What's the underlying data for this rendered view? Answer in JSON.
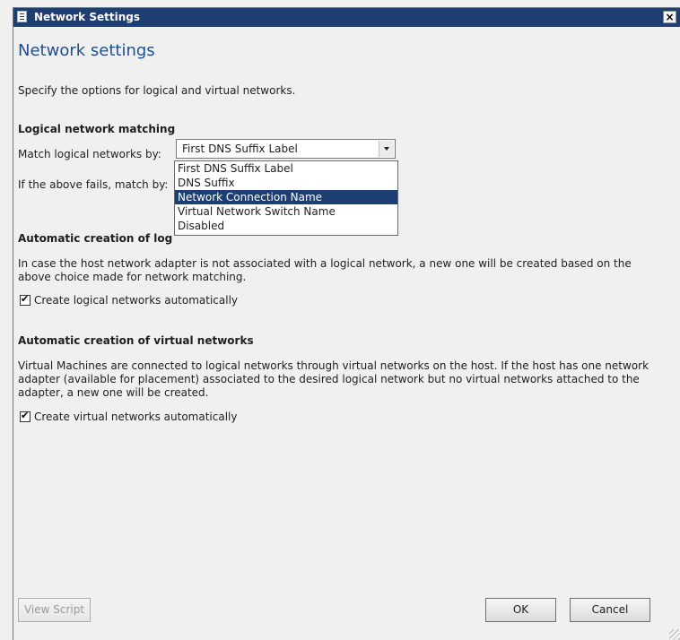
{
  "window": {
    "title": "Network Settings",
    "close_glyph": "×"
  },
  "heading": "Network settings",
  "intro": "Specify the options for logical and virtual networks.",
  "logical_matching": {
    "heading": "Logical network matching",
    "match_label": "Match logical networks by:",
    "match_value": "First DNS Suffix Label",
    "fallback_label": "If the above fails, match by:",
    "options": [
      "First DNS Suffix Label",
      "DNS Suffix",
      "Network Connection Name",
      "Virtual Network Switch Name",
      "Disabled"
    ],
    "highlighted_option": "Network Connection Name"
  },
  "auto_logical": {
    "heading": "Automatic creation of log",
    "description": "In case the host network adapter is not associated with a logical network, a new one will be created based on the above choice made for network matching.",
    "checkbox_label": "Create logical networks automatically",
    "checked": true
  },
  "auto_virtual": {
    "heading": "Automatic creation of virtual networks",
    "description": "Virtual Machines are connected to logical networks through virtual networks on the host. If the host has one network adapter (available for placement) associated to the desired logical network but no virtual networks attached to the adapter, a new one will be created.",
    "checkbox_label": "Create virtual networks automatically",
    "checked": true
  },
  "footer": {
    "view_script": "View Script",
    "ok": "OK",
    "cancel": "Cancel"
  },
  "colors": {
    "titlebar": "#1f3f73",
    "heading": "#1e4f8f",
    "selection": "#1d3e70"
  }
}
